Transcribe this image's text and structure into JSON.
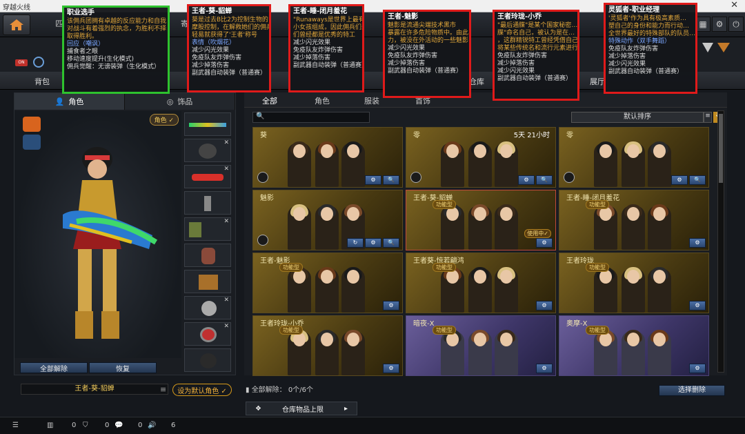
{
  "window": {
    "title": "穿越火线",
    "close": "✕"
  },
  "topnav": {
    "tabs": [
      "匹配",
      "寄",
      "单",
      "商城",
      "英雄",
      "巡"
    ]
  },
  "cattabs": [
    "背包",
    "商城",
    "仓库",
    "角色",
    "展厅"
  ],
  "leftpanel": {
    "subtabs": [
      "角色",
      "饰品"
    ],
    "role_badge": "角色 ✓",
    "unequip_all": "全部解除",
    "restore": "恢复",
    "current_name": "王者-葵-貂蝉",
    "set_default": "设为默认角色 ✓"
  },
  "rightpanel": {
    "tabs": [
      "全部",
      "角色",
      "服装",
      "首饰"
    ],
    "sort_label": "默认排序",
    "cards": [
      {
        "name": "葵",
        "time": "",
        "feature": "",
        "in_use": "",
        "btns": [
          "⚙",
          "🔍"
        ],
        "purple": false,
        "selected": false
      },
      {
        "name": "零",
        "time": "5天 21小时",
        "feature": "",
        "in_use": "",
        "btns": [
          "⚙",
          "🔍"
        ],
        "purple": false,
        "selected": false
      },
      {
        "name": "零",
        "time": "",
        "feature": "",
        "in_use": "",
        "btns": [
          "⚙",
          "🔍"
        ],
        "purple": false,
        "selected": false
      },
      {
        "name": "魅影",
        "time": "",
        "feature": "",
        "in_use": "",
        "btns": [
          "↻",
          "⚙",
          "🔍"
        ],
        "purple": false,
        "selected": false
      },
      {
        "name": "王者-葵-貂蝉",
        "time": "",
        "feature": "功能型",
        "in_use": "使用中✓",
        "btns": [
          "⚙"
        ],
        "purple": false,
        "selected": true
      },
      {
        "name": "王者-睡-闭月羞花",
        "time": "",
        "feature": "功能型",
        "in_use": "",
        "btns": [
          "⚙"
        ],
        "purple": false,
        "selected": false
      },
      {
        "name": "王者-魅影",
        "time": "",
        "feature": "功能型",
        "in_use": "",
        "btns": [
          "⚙"
        ],
        "purple": false,
        "selected": false
      },
      {
        "name": "王者葵-惊若翩鸿",
        "time": "",
        "feature": "功能型",
        "in_use": "",
        "btns": [
          "⚙"
        ],
        "purple": false,
        "selected": false
      },
      {
        "name": "王者玲珑",
        "time": "",
        "feature": "功能型",
        "in_use": "",
        "btns": [
          "⚙"
        ],
        "purple": false,
        "selected": false
      },
      {
        "name": "王者玲珑-小乔",
        "time": "",
        "feature": "功能型",
        "in_use": "",
        "btns": [
          "⚙"
        ],
        "purple": false,
        "selected": false
      },
      {
        "name": "暗夜-X",
        "time": "",
        "feature": "功能型",
        "in_use": "",
        "btns": [
          "⚙"
        ],
        "purple": true,
        "selected": false
      },
      {
        "name": "奥摩-X",
        "time": "",
        "feature": "功能型",
        "in_use": "",
        "btns": [
          "⚙"
        ],
        "purple": true,
        "selected": false
      }
    ],
    "unequip_count": "全部解除：  0个/6个",
    "batch_delete": "选择删除",
    "warehouse_limit": "仓库物品上限"
  },
  "status": {
    "v1": "0",
    "v2": "0",
    "v3": "0",
    "v4": "6"
  },
  "tooltips": [
    {
      "title": "职业选手",
      "lines": [
        "该佣兵团拥有卓越的反应能力和自我",
        "对战斗有着强烈的执念，为胜利不择",
        "取得胜利。"
      ],
      "sub": "回应（嘲讽）",
      "effects": [
        "捕食者之眼",
        "移动速度提升(生化模式)",
        "佣兵觉醒：无谤装弹（生化模式）"
      ]
    },
    {
      "title": "王者-葵-貂蝉",
      "lines": [
        "葵是过去B比2为控制生物的",
        "摩股控制，在解救她们的佣兵…",
        "轻易就获得了'王者'称号"
      ],
      "sub": "表情（吹烟花）",
      "effects": [
        "减少闪光效果",
        "免疫队友炸弹伤害",
        "减少掉落伤害",
        "副武器自动装弹（普通赛）"
      ]
    },
    {
      "title": "王者-睡-闭月羞花",
      "lines": [
        "\"Runaways是世界上最有名",
        "小女孩组成，因此佣兵们最爱",
        "们曾经都是优秀的特工"
      ],
      "sub": "",
      "effects": [
        "减少闪光效果",
        "免疫队友炸弹伤害",
        "减少掉落伤害",
        "副武器自动装弹（普通赛）"
      ]
    },
    {
      "title": "王者-魅影",
      "lines": [
        "魅影是流通尖端技术黑市",
        "暴露在许多危险物质中。由此",
        "力，被没在外活动的一些魅影"
      ],
      "sub": "",
      "effects": [
        "减少闪光效果",
        "免疫队友炸弹伤害",
        "减少掉落伤害",
        "副武器自动装弹（普通赛）"
      ]
    },
    {
      "title": "王者玲珑-小乔",
      "lines": [
        "\"最后通牒\"是某个国家秘密…",
        "牒\"命名自己，被认为是在…",
        "，这群精锐特工曾经凭借自己…",
        "将某些传统名和流行元素进行…"
      ],
      "sub": "",
      "effects": [
        "免疫队友炸弹伤害",
        "减少掉落伤害",
        "减少闪光效果",
        "副武器自动装弹（普通赛）"
      ]
    },
    {
      "title": "灵狐者-职业经理",
      "lines": [
        "'灵狐者'作为具有极高素质…",
        "塑自己的身份和能力而行动…",
        "全世界最好的特殊部队的队员…"
      ],
      "sub": "特殊动作（双手舞蹈）",
      "effects": [
        "免疫队友炸弹伤害",
        "减少掉落伤害",
        "减少闪光效果",
        "副武器自动装弹（普通赛）"
      ]
    }
  ]
}
